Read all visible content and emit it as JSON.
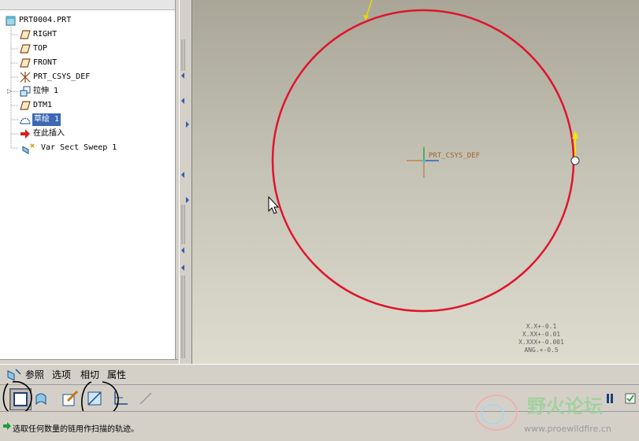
{
  "model_tree": {
    "root": "PRT0004.PRT",
    "items": [
      {
        "label": "RIGHT",
        "icon": "datum-plane-icon"
      },
      {
        "label": "TOP",
        "icon": "datum-plane-icon"
      },
      {
        "label": "FRONT",
        "icon": "datum-plane-icon"
      },
      {
        "label": "PRT_CSYS_DEF",
        "icon": "coordinate-system-icon"
      },
      {
        "label": "拉伸 1",
        "icon": "extrude-icon"
      },
      {
        "label": "DTM1",
        "icon": "datum-plane-icon"
      },
      {
        "label": "草绘 1",
        "icon": "sketch-icon",
        "selected": true
      },
      {
        "label": "在此插入",
        "icon": "insert-here-arrow-icon"
      },
      {
        "label": "Var Sect Sweep 1",
        "icon": "var-sect-sweep-icon"
      }
    ]
  },
  "graphics": {
    "csys_label": "PRT_CSYS_DEF",
    "tolerances": [
      "X.X+-0.1",
      "X.XX+-0.01",
      "X.XXX+-0.001",
      "ANG.+-0.5"
    ],
    "curve_color": "#e0142c"
  },
  "dashboard": {
    "tabs": [
      "参照",
      "选项",
      "相切",
      "属性"
    ],
    "status_message": "选取任何数量的链用作扫描的轨迹。",
    "watermark_title": "野火论坛",
    "watermark_url": "www.proewildfire.cn"
  }
}
